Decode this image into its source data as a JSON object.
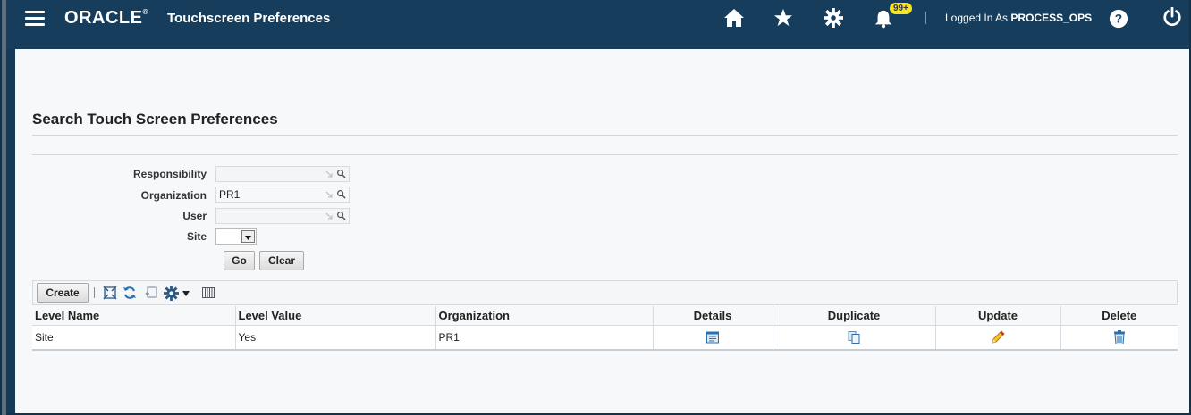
{
  "header": {
    "logo_text": "ORACLE",
    "app_title": "Touchscreen Preferences",
    "notification_count": "99+",
    "logged_in_prefix": "Logged In As",
    "username": "PROCESS_OPS"
  },
  "page": {
    "title": "Search Touch Screen Preferences"
  },
  "search": {
    "responsibility_label": "Responsibility",
    "responsibility_value": "",
    "organization_label": "Organization",
    "organization_value": "PR1",
    "user_label": "User",
    "user_value": "",
    "site_label": "Site",
    "site_value": "",
    "go_label": "Go",
    "clear_label": "Clear"
  },
  "toolbar": {
    "create_label": "Create"
  },
  "table": {
    "columns": [
      "Level Name",
      "Level Value",
      "Organization",
      "Details",
      "Duplicate",
      "Update",
      "Delete"
    ],
    "rows": [
      {
        "level_name": "Site",
        "level_value": "Yes",
        "organization": "PR1"
      }
    ]
  },
  "colors": {
    "header_bg": "#163e5c",
    "badge": "#f5e52a",
    "page_bg": "#f7f8f9",
    "icon_blue": "#2a6fb0"
  },
  "icons": [
    "menu-icon",
    "home-icon",
    "favorites-icon",
    "settings-icon",
    "notifications-icon",
    "help-icon",
    "power-icon"
  ]
}
